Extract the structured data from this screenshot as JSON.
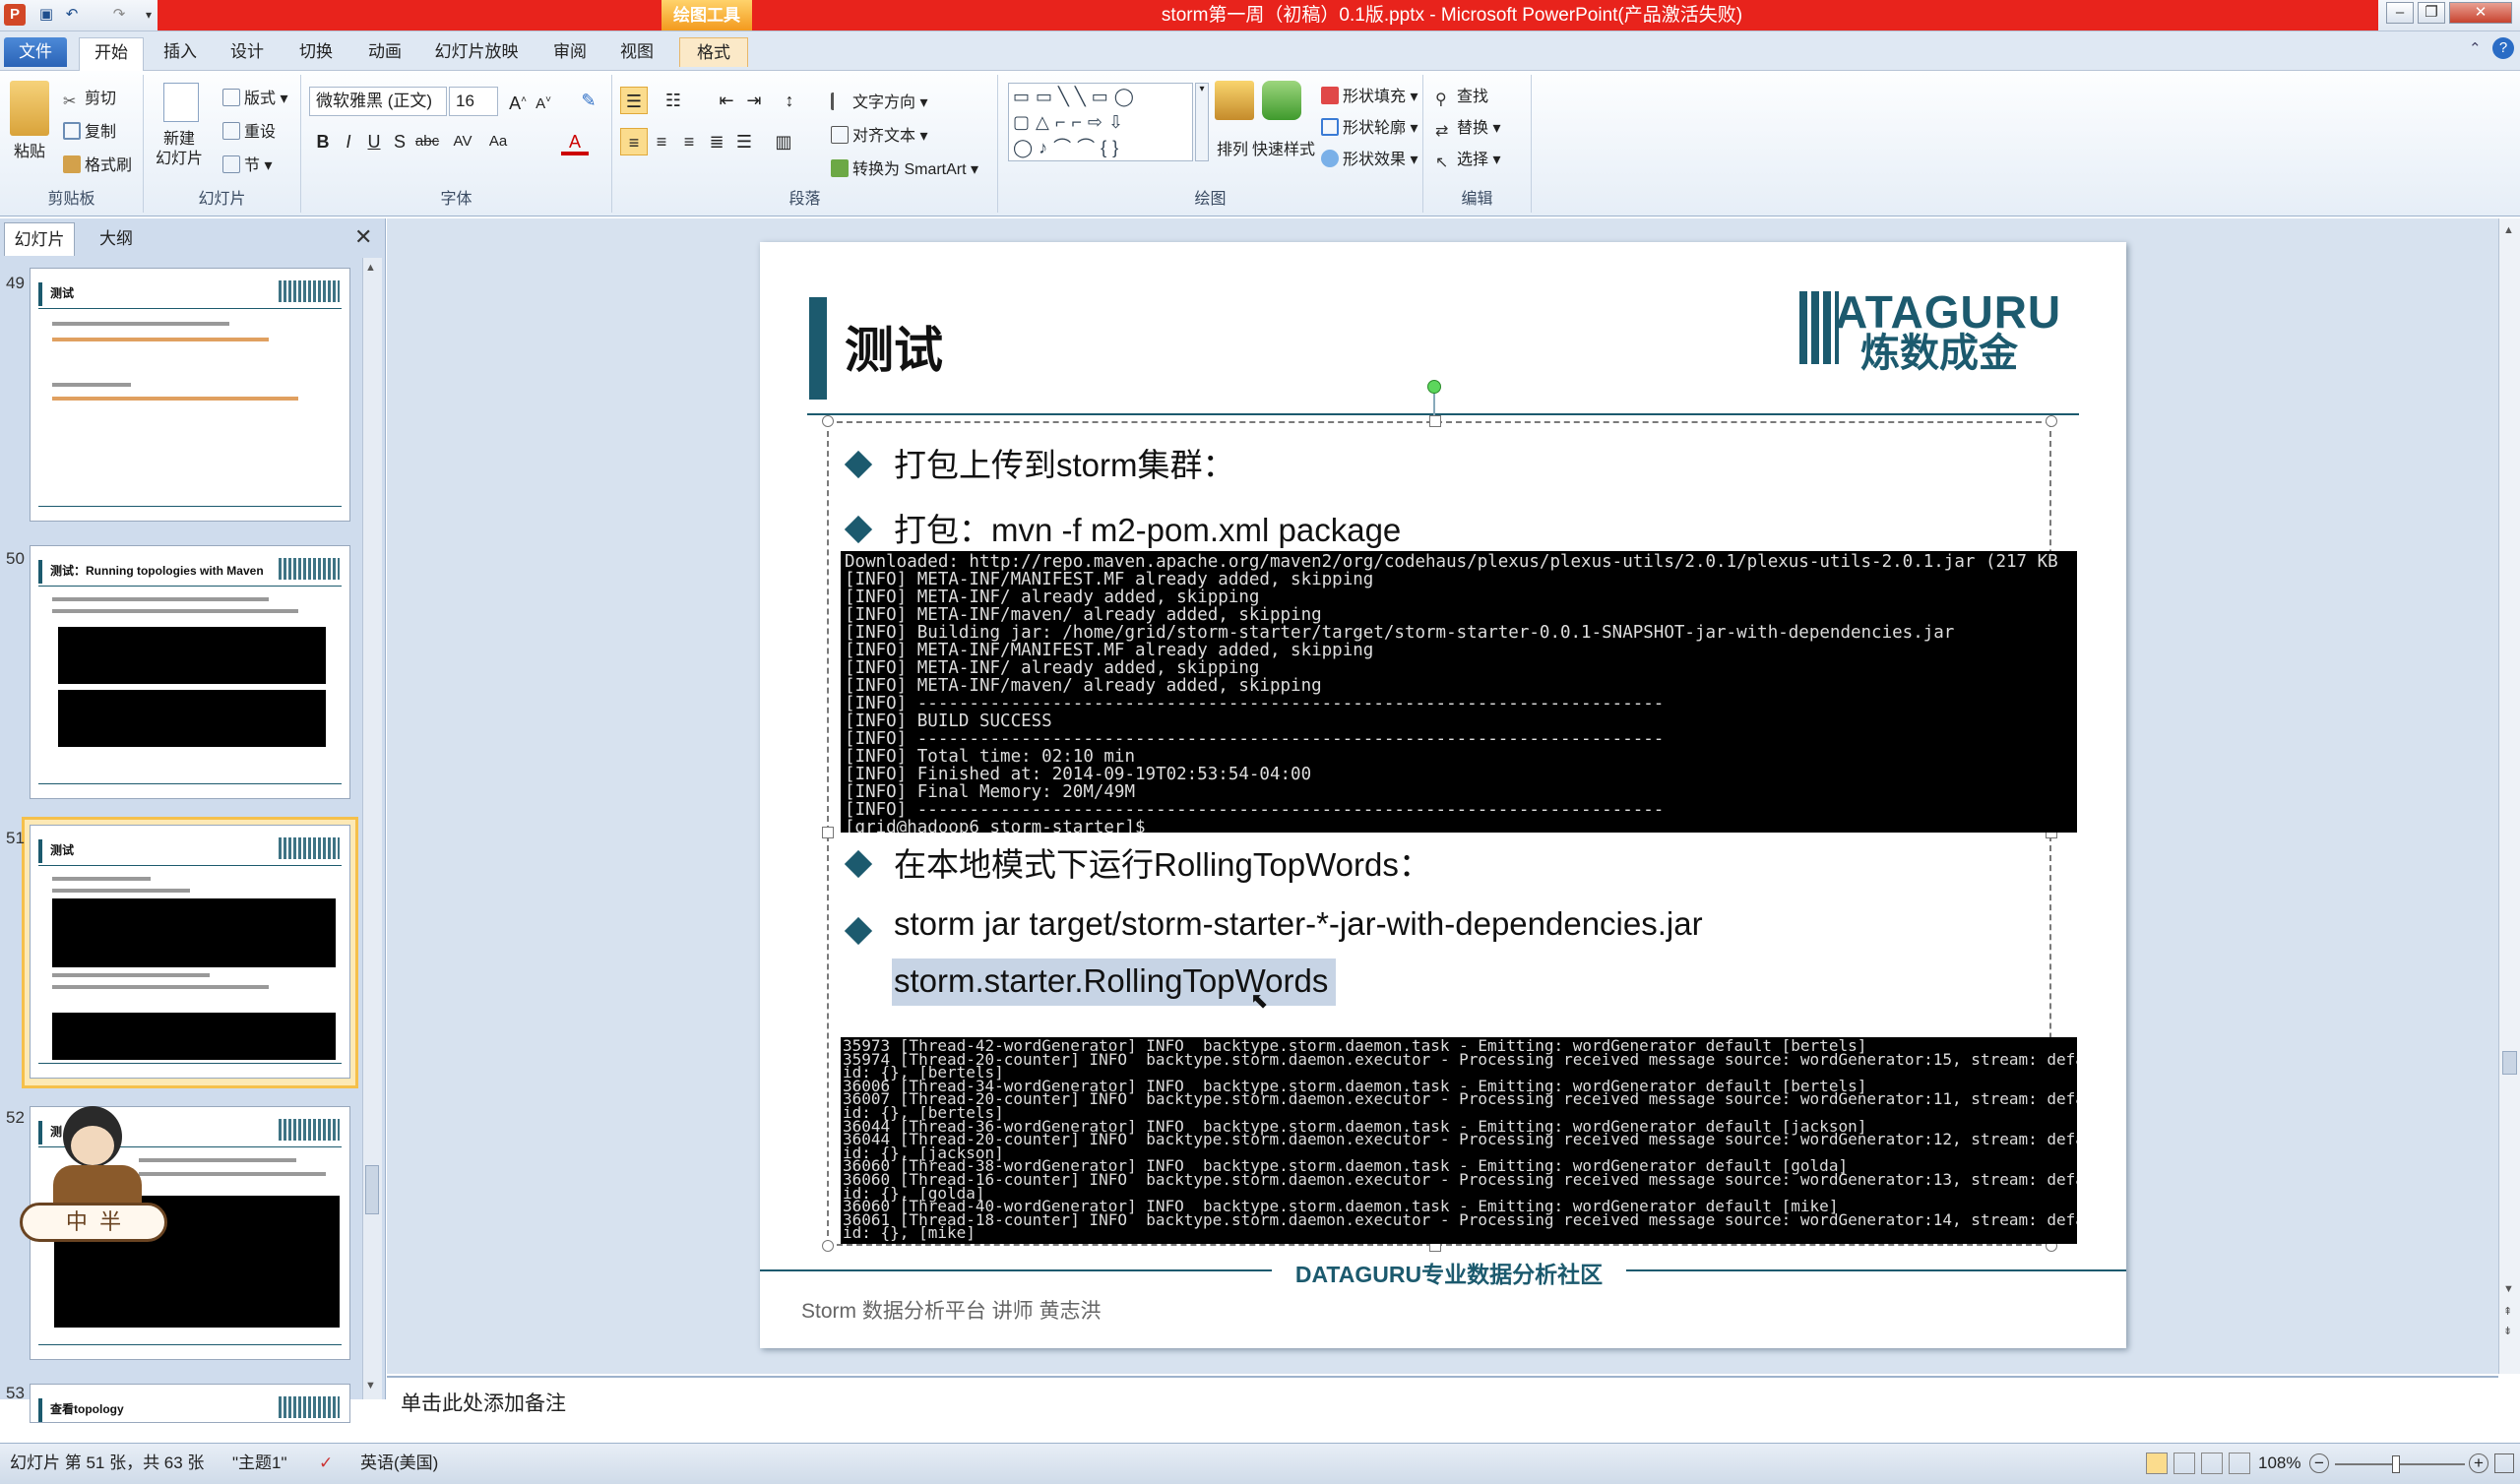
{
  "window": {
    "tool_tag": "绘图工具",
    "title": "storm第一周（初稿）0.1版.pptx - Microsoft PowerPoint(产品激活失败)",
    "controls": [
      "–",
      "❐",
      "✕"
    ]
  },
  "tabs": [
    "文件",
    "开始",
    "插入",
    "设计",
    "切换",
    "动画",
    "幻灯片放映",
    "审阅",
    "视图",
    "格式"
  ],
  "ribbon": {
    "clipboard": {
      "paste": "粘贴",
      "cut": "剪切",
      "copy": "复制",
      "format_painter": "格式刷",
      "label": "剪贴板"
    },
    "slides": {
      "new_slide": "新建\n幻灯片",
      "layout": "版式",
      "reset": "重设",
      "section": "节",
      "label": "幻灯片"
    },
    "font": {
      "name": "微软雅黑 (正文)",
      "size": "16",
      "label": "字体"
    },
    "paragraph": {
      "text_direction": "文字方向",
      "align_text": "对齐文本",
      "smartart": "转换为 SmartArt",
      "label": "段落"
    },
    "drawing": {
      "arrange": "排列",
      "quick_styles": "快速样式",
      "fill": "形状填充",
      "outline": "形状轮廓",
      "effects": "形状效果",
      "label": "绘图"
    },
    "editing": {
      "find": "查找",
      "replace": "替换",
      "select": "选择",
      "label": "编辑"
    }
  },
  "left_panel": {
    "tabs": [
      "幻灯片",
      "大纲"
    ],
    "thumbs": [
      {
        "num": "49",
        "title": "测试"
      },
      {
        "num": "50",
        "title": "测试：Running topologies with Maven"
      },
      {
        "num": "51",
        "title": "测试"
      },
      {
        "num": "52",
        "title": "测"
      },
      {
        "num": "53",
        "title": "查看topology"
      }
    ],
    "avatar_text": "中  半"
  },
  "slide": {
    "title": "测试",
    "logo_line1": "ATAGURU",
    "logo_line2": "炼数成金",
    "bullets": [
      "打包上传到storm集群：",
      "打包：mvn -f m2-pom.xml package",
      "在本地模式下运行RollingTopWords：",
      "storm jar target/storm-starter-*-jar-with-dependencies.jar"
    ],
    "highlight": "storm.starter.RollingTopWords",
    "terminal1": "Downloaded: http://repo.maven.apache.org/maven2/org/codehaus/plexus/plexus-utils/2.0.1/plexus-utils-2.0.1.jar (217 KB\n[INFO] META-INF/MANIFEST.MF already added, skipping\n[INFO] META-INF/ already added, skipping\n[INFO] META-INF/maven/ already added, skipping\n[INFO] Building jar: /home/grid/storm-starter/target/storm-starter-0.0.1-SNAPSHOT-jar-with-dependencies.jar\n[INFO] META-INF/MANIFEST.MF already added, skipping\n[INFO] META-INF/ already added, skipping\n[INFO] META-INF/maven/ already added, skipping\n[INFO] ------------------------------------------------------------------------\n[INFO] BUILD SUCCESS\n[INFO] ------------------------------------------------------------------------\n[INFO] Total time: 02:10 min\n[INFO] Finished at: 2014-09-19T02:53:54-04:00\n[INFO] Final Memory: 20M/49M\n[INFO] ------------------------------------------------------------------------\n[grid@hadoop6 storm-starter]$",
    "terminal2": "35973 [Thread-42-wordGenerator] INFO  backtype.storm.daemon.task - Emitting: wordGenerator default [bertels]\n35974 [Thread-20-counter] INFO  backtype.storm.daemon.executor - Processing received message source: wordGenerator:15, stream: default,\nid: {}, [bertels]\n36006 [Thread-34-wordGenerator] INFO  backtype.storm.daemon.task - Emitting: wordGenerator default [bertels]\n36007 [Thread-20-counter] INFO  backtype.storm.daemon.executor - Processing received message source: wordGenerator:11, stream: default,\nid: {}, [bertels]\n36044 [Thread-36-wordGenerator] INFO  backtype.storm.daemon.task - Emitting: wordGenerator default [jackson]\n36044 [Thread-20-counter] INFO  backtype.storm.daemon.executor - Processing received message source: wordGenerator:12, stream: default,\nid: {}, [jackson]\n36060 [Thread-38-wordGenerator] INFO  backtype.storm.daemon.task - Emitting: wordGenerator default [golda]\n36060 [Thread-16-counter] INFO  backtype.storm.daemon.executor - Processing received message source: wordGenerator:13, stream: default,\nid: {}, [golda]\n36060 [Thread-40-wordGenerator] INFO  backtype.storm.daemon.task - Emitting: wordGenerator default [mike]\n36061 [Thread-18-counter] INFO  backtype.storm.daemon.executor - Processing received message source: wordGenerator:14, stream: default,\nid: {}, [mike]",
    "footer_center": "DATAGURU专业数据分析社区",
    "footer_left": "Storm 数据分析平台 讲师  黄志洪"
  },
  "notes_placeholder": "单击此处添加备注",
  "status": {
    "slide_info": "幻灯片 第 51 张，共 63 张",
    "theme": "\"主题1\"",
    "language": "英语(美国)",
    "zoom": "108%"
  },
  "colors": {
    "accent": "#1c5a6e",
    "titlebar_red": "#e8231c",
    "selection": "#c7d4e5"
  }
}
